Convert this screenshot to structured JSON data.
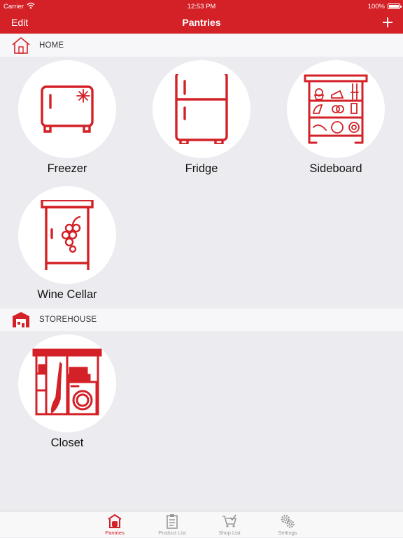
{
  "status": {
    "carrier": "Carrier",
    "time": "12:53 PM",
    "battery": "100%"
  },
  "nav": {
    "edit": "Edit",
    "title": "Pantries"
  },
  "sections": [
    {
      "label": "HOME",
      "tiles": [
        "Freezer",
        "Fridge",
        "Sideboard",
        "Wine Cellar"
      ]
    },
    {
      "label": "STOREHOUSE",
      "tiles": [
        "Closet"
      ]
    }
  ],
  "tabs": [
    {
      "label": "Pantries",
      "icon": "pantries-icon",
      "active": true
    },
    {
      "label": "Product List",
      "icon": "clipboard-icon",
      "active": false
    },
    {
      "label": "Shop List",
      "icon": "cart-icon",
      "active": false
    },
    {
      "label": "Settings",
      "icon": "gears-icon",
      "active": false
    }
  ],
  "colors": {
    "brand": "#d32127",
    "background": "#ececf0",
    "tab_inactive": "#999999"
  }
}
